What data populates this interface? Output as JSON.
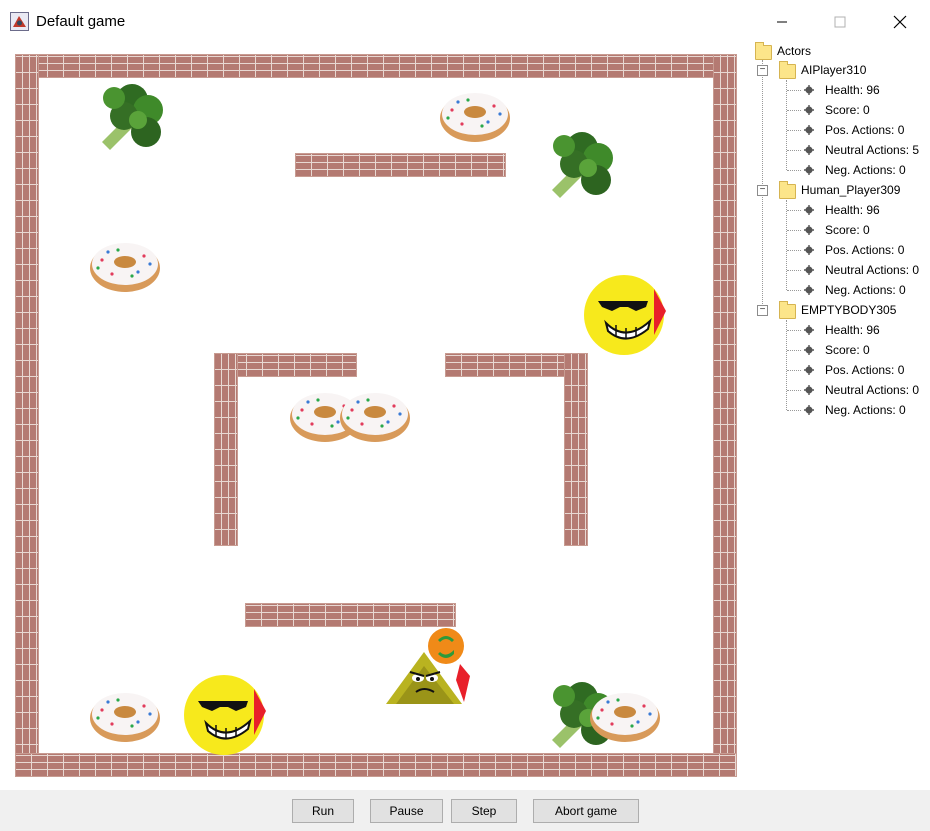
{
  "window": {
    "title": "Default game"
  },
  "tree": {
    "root_label": "Actors",
    "actors": [
      {
        "name": "AIPlayer310",
        "stats": [
          "Health: 96",
          "Score: 0",
          "Pos. Actions: 0",
          "Neutral Actions: 5",
          "Neg. Actions: 0"
        ]
      },
      {
        "name": "Human_Player309",
        "stats": [
          "Health: 96",
          "Score: 0",
          "Pos. Actions: 0",
          "Neutral Actions: 0",
          "Neg. Actions: 0"
        ]
      },
      {
        "name": "EMPTYBODY305",
        "stats": [
          "Health: 96",
          "Score: 0",
          "Pos. Actions: 0",
          "Neutral Actions: 0",
          "Neg. Actions: 0"
        ]
      }
    ]
  },
  "buttons": {
    "run": "Run",
    "pause": "Pause",
    "step": "Step",
    "abort": "Abort game"
  },
  "colors": {
    "brick": "#b47a72",
    "mortar": "#e8d8d2",
    "smiley": "#f7e91c",
    "broccoli": "#3f8a2a",
    "donut": "#e6b277",
    "bottom_bar": "#f0f0f0"
  },
  "sprites": {
    "broccoli": "broccoli-icon",
    "donut": "donut-icon",
    "player": "sunglasses-smiley-icon",
    "enemy": "angry-goblin-icon"
  }
}
